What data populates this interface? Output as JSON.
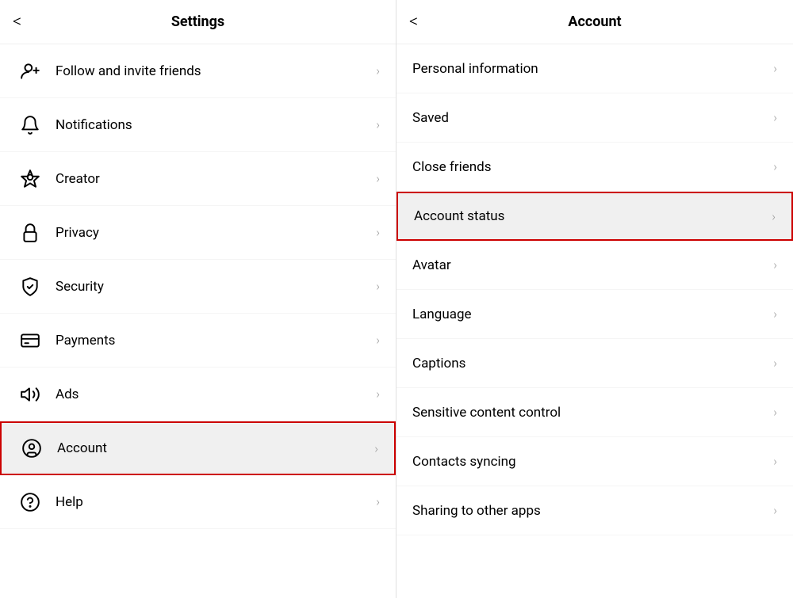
{
  "settings": {
    "title": "Settings",
    "back_label": "<",
    "items": [
      {
        "id": "follow",
        "label": "Follow and invite friends",
        "icon": "follow-icon",
        "highlighted": false
      },
      {
        "id": "notifications",
        "label": "Notifications",
        "icon": "notification-icon",
        "highlighted": false
      },
      {
        "id": "creator",
        "label": "Creator",
        "icon": "creator-icon",
        "highlighted": false
      },
      {
        "id": "privacy",
        "label": "Privacy",
        "icon": "privacy-icon",
        "highlighted": false
      },
      {
        "id": "security",
        "label": "Security",
        "icon": "security-icon",
        "highlighted": false
      },
      {
        "id": "payments",
        "label": "Payments",
        "icon": "payments-icon",
        "highlighted": false
      },
      {
        "id": "ads",
        "label": "Ads",
        "icon": "ads-icon",
        "highlighted": false
      },
      {
        "id": "account",
        "label": "Account",
        "icon": "account-icon",
        "highlighted": true
      },
      {
        "id": "help",
        "label": "Help",
        "icon": "help-icon",
        "highlighted": false
      }
    ]
  },
  "account": {
    "title": "Account",
    "back_label": "<",
    "items": [
      {
        "id": "personal-information",
        "label": "Personal information",
        "highlighted": false
      },
      {
        "id": "saved",
        "label": "Saved",
        "highlighted": false
      },
      {
        "id": "close-friends",
        "label": "Close friends",
        "highlighted": false
      },
      {
        "id": "account-status",
        "label": "Account status",
        "highlighted": true
      },
      {
        "id": "avatar",
        "label": "Avatar",
        "highlighted": false
      },
      {
        "id": "language",
        "label": "Language",
        "highlighted": false
      },
      {
        "id": "captions",
        "label": "Captions",
        "highlighted": false
      },
      {
        "id": "sensitive-content",
        "label": "Sensitive content control",
        "highlighted": false
      },
      {
        "id": "contacts-syncing",
        "label": "Contacts syncing",
        "highlighted": false
      },
      {
        "id": "sharing",
        "label": "Sharing to other apps",
        "highlighted": false
      }
    ]
  },
  "chevron": "›",
  "colors": {
    "highlight_border": "#cc0000",
    "highlight_bg": "#f0f0f0"
  }
}
